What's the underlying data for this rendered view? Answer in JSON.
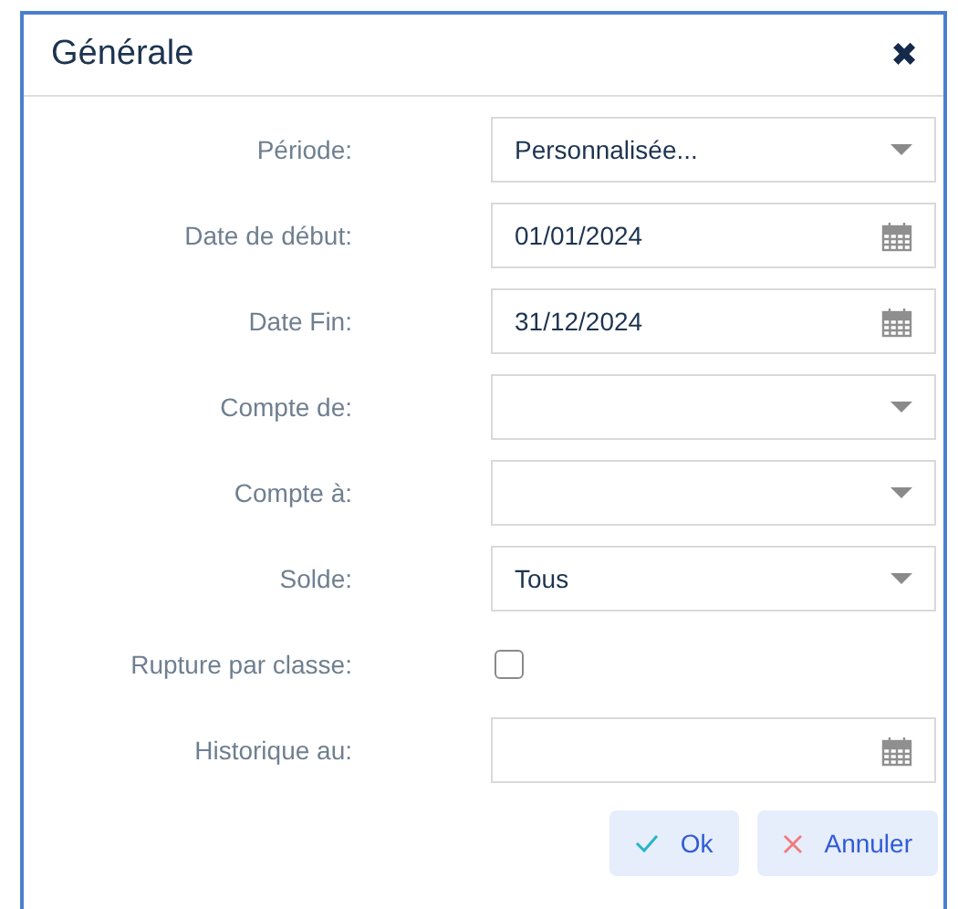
{
  "dialog": {
    "title": "Générale",
    "close": "✖"
  },
  "fields": [
    {
      "label": "Période:",
      "kind": "select",
      "value": "Personnalisée..."
    },
    {
      "label": "Date de début:",
      "kind": "date",
      "value": "01/01/2024"
    },
    {
      "label": "Date Fin:",
      "kind": "date",
      "value": "31/12/2024"
    },
    {
      "label": "Compte de:",
      "kind": "select"
    },
    {
      "label": "Compte à:",
      "kind": "select"
    },
    {
      "label": "Solde:",
      "kind": "select",
      "value": "Tous"
    },
    {
      "label": "Rupture par classe:",
      "kind": "checkbox",
      "checked": false
    },
    {
      "label": "Historique au:",
      "kind": "date"
    }
  ],
  "buttons": [
    {
      "label": "Ok",
      "kind": "ok"
    },
    {
      "label": "Annuler",
      "kind": "cancel"
    }
  ]
}
